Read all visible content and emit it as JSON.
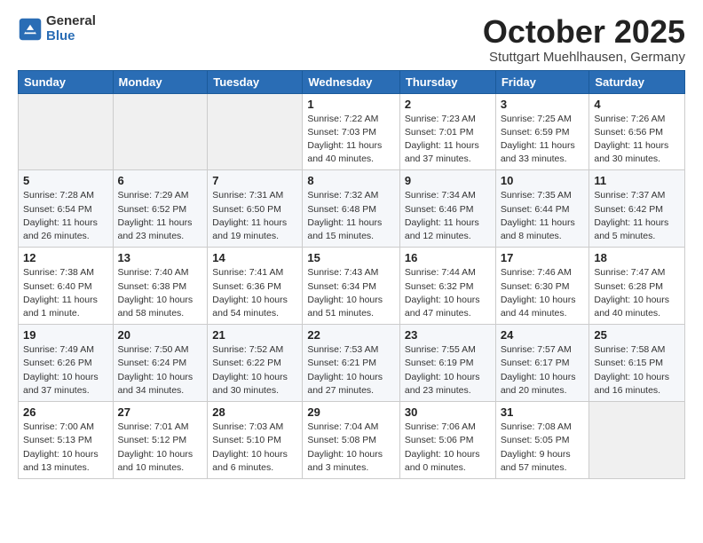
{
  "header": {
    "logo_general": "General",
    "logo_blue": "Blue",
    "month_title": "October 2025",
    "location": "Stuttgart Muehlhausen, Germany"
  },
  "weekdays": [
    "Sunday",
    "Monday",
    "Tuesday",
    "Wednesday",
    "Thursday",
    "Friday",
    "Saturday"
  ],
  "weeks": [
    [
      {
        "day": "",
        "info": ""
      },
      {
        "day": "",
        "info": ""
      },
      {
        "day": "",
        "info": ""
      },
      {
        "day": "1",
        "info": "Sunrise: 7:22 AM\nSunset: 7:03 PM\nDaylight: 11 hours and 40 minutes."
      },
      {
        "day": "2",
        "info": "Sunrise: 7:23 AM\nSunset: 7:01 PM\nDaylight: 11 hours and 37 minutes."
      },
      {
        "day": "3",
        "info": "Sunrise: 7:25 AM\nSunset: 6:59 PM\nDaylight: 11 hours and 33 minutes."
      },
      {
        "day": "4",
        "info": "Sunrise: 7:26 AM\nSunset: 6:56 PM\nDaylight: 11 hours and 30 minutes."
      }
    ],
    [
      {
        "day": "5",
        "info": "Sunrise: 7:28 AM\nSunset: 6:54 PM\nDaylight: 11 hours and 26 minutes."
      },
      {
        "day": "6",
        "info": "Sunrise: 7:29 AM\nSunset: 6:52 PM\nDaylight: 11 hours and 23 minutes."
      },
      {
        "day": "7",
        "info": "Sunrise: 7:31 AM\nSunset: 6:50 PM\nDaylight: 11 hours and 19 minutes."
      },
      {
        "day": "8",
        "info": "Sunrise: 7:32 AM\nSunset: 6:48 PM\nDaylight: 11 hours and 15 minutes."
      },
      {
        "day": "9",
        "info": "Sunrise: 7:34 AM\nSunset: 6:46 PM\nDaylight: 11 hours and 12 minutes."
      },
      {
        "day": "10",
        "info": "Sunrise: 7:35 AM\nSunset: 6:44 PM\nDaylight: 11 hours and 8 minutes."
      },
      {
        "day": "11",
        "info": "Sunrise: 7:37 AM\nSunset: 6:42 PM\nDaylight: 11 hours and 5 minutes."
      }
    ],
    [
      {
        "day": "12",
        "info": "Sunrise: 7:38 AM\nSunset: 6:40 PM\nDaylight: 11 hours and 1 minute."
      },
      {
        "day": "13",
        "info": "Sunrise: 7:40 AM\nSunset: 6:38 PM\nDaylight: 10 hours and 58 minutes."
      },
      {
        "day": "14",
        "info": "Sunrise: 7:41 AM\nSunset: 6:36 PM\nDaylight: 10 hours and 54 minutes."
      },
      {
        "day": "15",
        "info": "Sunrise: 7:43 AM\nSunset: 6:34 PM\nDaylight: 10 hours and 51 minutes."
      },
      {
        "day": "16",
        "info": "Sunrise: 7:44 AM\nSunset: 6:32 PM\nDaylight: 10 hours and 47 minutes."
      },
      {
        "day": "17",
        "info": "Sunrise: 7:46 AM\nSunset: 6:30 PM\nDaylight: 10 hours and 44 minutes."
      },
      {
        "day": "18",
        "info": "Sunrise: 7:47 AM\nSunset: 6:28 PM\nDaylight: 10 hours and 40 minutes."
      }
    ],
    [
      {
        "day": "19",
        "info": "Sunrise: 7:49 AM\nSunset: 6:26 PM\nDaylight: 10 hours and 37 minutes."
      },
      {
        "day": "20",
        "info": "Sunrise: 7:50 AM\nSunset: 6:24 PM\nDaylight: 10 hours and 34 minutes."
      },
      {
        "day": "21",
        "info": "Sunrise: 7:52 AM\nSunset: 6:22 PM\nDaylight: 10 hours and 30 minutes."
      },
      {
        "day": "22",
        "info": "Sunrise: 7:53 AM\nSunset: 6:21 PM\nDaylight: 10 hours and 27 minutes."
      },
      {
        "day": "23",
        "info": "Sunrise: 7:55 AM\nSunset: 6:19 PM\nDaylight: 10 hours and 23 minutes."
      },
      {
        "day": "24",
        "info": "Sunrise: 7:57 AM\nSunset: 6:17 PM\nDaylight: 10 hours and 20 minutes."
      },
      {
        "day": "25",
        "info": "Sunrise: 7:58 AM\nSunset: 6:15 PM\nDaylight: 10 hours and 16 minutes."
      }
    ],
    [
      {
        "day": "26",
        "info": "Sunrise: 7:00 AM\nSunset: 5:13 PM\nDaylight: 10 hours and 13 minutes."
      },
      {
        "day": "27",
        "info": "Sunrise: 7:01 AM\nSunset: 5:12 PM\nDaylight: 10 hours and 10 minutes."
      },
      {
        "day": "28",
        "info": "Sunrise: 7:03 AM\nSunset: 5:10 PM\nDaylight: 10 hours and 6 minutes."
      },
      {
        "day": "29",
        "info": "Sunrise: 7:04 AM\nSunset: 5:08 PM\nDaylight: 10 hours and 3 minutes."
      },
      {
        "day": "30",
        "info": "Sunrise: 7:06 AM\nSunset: 5:06 PM\nDaylight: 10 hours and 0 minutes."
      },
      {
        "day": "31",
        "info": "Sunrise: 7:08 AM\nSunset: 5:05 PM\nDaylight: 9 hours and 57 minutes."
      },
      {
        "day": "",
        "info": ""
      }
    ]
  ]
}
